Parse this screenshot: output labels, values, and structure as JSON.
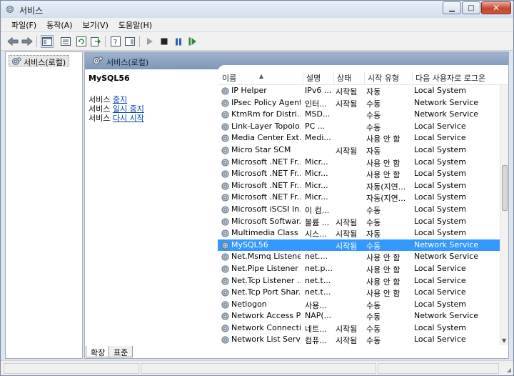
{
  "window": {
    "title": "서비스"
  },
  "menu": [
    {
      "label": "파일(F)"
    },
    {
      "label": "동작(A)"
    },
    {
      "label": "보기(V)"
    },
    {
      "label": "도움말(H)"
    }
  ],
  "tree": {
    "root_label": "서비스(로컬)"
  },
  "pane_header": {
    "title": "서비스(로컬)"
  },
  "detail": {
    "service_name": "MySQL56",
    "prefix": "서비스",
    "stop_link": "중지",
    "pause_link": "일시 중지",
    "restart_link": "다시 시작"
  },
  "columns": {
    "name": "이름",
    "description": "설명",
    "status": "상태",
    "startup_type": "시작 유형",
    "logon_as": "다음 사용자로 로그온"
  },
  "rows": [
    {
      "name": "IP Helper",
      "desc": "IPv6 ...",
      "status": "시작됨",
      "start": "자동",
      "logon": "Local System"
    },
    {
      "name": "IPsec Policy Agent",
      "desc": "인터...",
      "status": "시작됨",
      "start": "수동",
      "logon": "Network Service"
    },
    {
      "name": "KtmRm for Distri...",
      "desc": "MSD...",
      "status": "",
      "start": "수동",
      "logon": "Network Service"
    },
    {
      "name": "Link-Layer Topolo...",
      "desc": "PC ...",
      "status": "",
      "start": "수동",
      "logon": "Local Service"
    },
    {
      "name": "Media Center Ext...",
      "desc": "Medi...",
      "status": "",
      "start": "사용 안 함",
      "logon": "Local Service"
    },
    {
      "name": "Micro Star SCM",
      "desc": "",
      "status": "시작됨",
      "start": "자동",
      "logon": "Local System"
    },
    {
      "name": "Microsoft .NET Fr...",
      "desc": "Micr...",
      "status": "",
      "start": "사용 안 함",
      "logon": "Local System"
    },
    {
      "name": "Microsoft .NET Fr...",
      "desc": "Micr...",
      "status": "",
      "start": "사용 안 함",
      "logon": "Local System"
    },
    {
      "name": "Microsoft .NET Fr...",
      "desc": "Micr...",
      "status": "",
      "start": "자동(지연...",
      "logon": "Local System"
    },
    {
      "name": "Microsoft .NET Fr...",
      "desc": "Micr...",
      "status": "",
      "start": "자동(지연...",
      "logon": "Local System"
    },
    {
      "name": "Microsoft iSCSI In...",
      "desc": "이 컴...",
      "status": "",
      "start": "수동",
      "logon": "Local System"
    },
    {
      "name": "Microsoft Softwar...",
      "desc": "볼륨 ...",
      "status": "시작됨",
      "start": "수동",
      "logon": "Local System"
    },
    {
      "name": "Multimedia Class ...",
      "desc": "시스...",
      "status": "시작됨",
      "start": "자동",
      "logon": "Local System"
    },
    {
      "name": "MySQL56",
      "desc": "",
      "status": "시작됨",
      "start": "수동",
      "logon": "Network Service",
      "selected": true
    },
    {
      "name": "Net.Msmq Listene...",
      "desc": "net....",
      "status": "",
      "start": "사용 안 함",
      "logon": "Network Service"
    },
    {
      "name": "Net.Pipe Listener ...",
      "desc": "net.p...",
      "status": "",
      "start": "사용 안 함",
      "logon": "Local Service"
    },
    {
      "name": "Net.Tcp Listener ...",
      "desc": "net.t...",
      "status": "",
      "start": "사용 안 함",
      "logon": "Local Service"
    },
    {
      "name": "Net.Tcp Port Shar...",
      "desc": "net.t...",
      "status": "",
      "start": "사용 안 함",
      "logon": "Local Service"
    },
    {
      "name": "Netlogon",
      "desc": "사용...",
      "status": "",
      "start": "수동",
      "logon": "Local System"
    },
    {
      "name": "Network Access P...",
      "desc": "NAP(...",
      "status": "",
      "start": "수동",
      "logon": "Network Service"
    },
    {
      "name": "Network Connecti...",
      "desc": "네트...",
      "status": "시작됨",
      "start": "수동",
      "logon": "Local System"
    },
    {
      "name": "Network List Servi...",
      "desc": "컴퓨...",
      "status": "시작됨",
      "start": "수동",
      "logon": "Local Service"
    }
  ],
  "tabs": [
    {
      "label": "확장"
    },
    {
      "label": "표준"
    }
  ],
  "colors": {
    "selection": "#3399ff",
    "pane_header": "#8fa6c4",
    "link": "#0645ad"
  }
}
